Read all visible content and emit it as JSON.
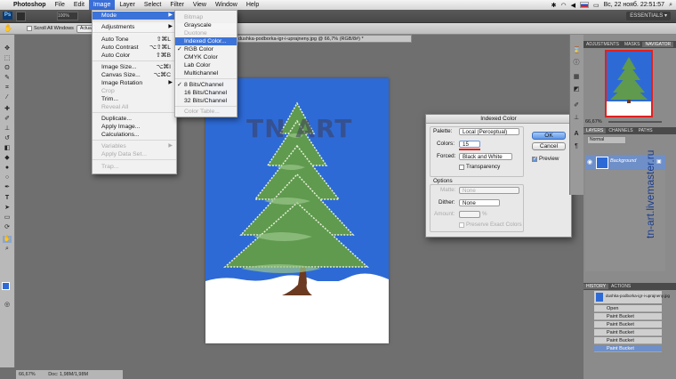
{
  "menubar": {
    "items": [
      "Photoshop",
      "File",
      "Edit",
      "Image",
      "Layer",
      "Select",
      "Filter",
      "View",
      "Window",
      "Help"
    ],
    "clock": "Вс, 22 нояб.  22:51:57"
  },
  "workspace": {
    "essentials": "ESSENTIALS ▾"
  },
  "optionsbar": {
    "scroll_all": "Scroll All Windows",
    "actual": "Actual"
  },
  "image_menu": {
    "mode": "Mode",
    "adjustments": "Adjustments",
    "auto_tone": "Auto Tone",
    "auto_tone_sc": "⇧⌘L",
    "auto_contrast": "Auto Contrast",
    "auto_contrast_sc": "⌥⇧⌘L",
    "auto_color": "Auto Color",
    "auto_color_sc": "⇧⌘B",
    "image_size": "Image Size...",
    "image_size_sc": "⌥⌘I",
    "canvas_size": "Canvas Size...",
    "canvas_size_sc": "⌥⌘C",
    "image_rotation": "Image Rotation",
    "crop": "Crop",
    "trim": "Trim...",
    "reveal_all": "Reveal All",
    "duplicate": "Duplicate...",
    "apply_image": "Apply Image...",
    "calculations": "Calculations...",
    "variables": "Variables",
    "apply_data_set": "Apply Data Set...",
    "trap": "Trap..."
  },
  "mode_menu": {
    "bitmap": "Bitmap",
    "grayscale": "Grayscale",
    "duotone": "Duotone",
    "indexed": "Indexed Color...",
    "rgb": "RGB Color",
    "cmyk": "CMYK Color",
    "lab": "Lab Color",
    "multichannel": "Multichannel",
    "b8": "8 Bits/Channel",
    "b16": "16 Bits/Channel",
    "b32": "32 Bits/Channel",
    "color_table": "Color Table..."
  },
  "doc_tab": {
    "title": "dushka-podborka-igr-i-uprajneny.jpg @ 66,7% (RGB/8#) *"
  },
  "canvas_watermark": "TN ART",
  "dialog": {
    "title": "Indexed Color",
    "palette_label": "Palette:",
    "palette_value": "Local (Perceptual)",
    "colors_label": "Colors:",
    "colors_value": "15",
    "forced_label": "Forced:",
    "forced_value": "Black and White",
    "transparency": "Transparency",
    "options_label": "Options",
    "matte_label": "Matte:",
    "matte_value": "None",
    "dither_label": "Dither:",
    "dither_value": "None",
    "amount_label": "Amount:",
    "amount_unit": "%",
    "preserve": "Preserve Exact Colors",
    "ok": "OK",
    "cancel": "Cancel",
    "preview": "Preview"
  },
  "navigator": {
    "tabs": [
      "ADJUSTMENTS",
      "MASKS",
      "NAVIGATOR"
    ],
    "zoom": "66,67%"
  },
  "layers": {
    "tabs": [
      "LAYERS",
      "CHANNELS",
      "PATHS"
    ],
    "blend": "Normal",
    "layer_name": "Background"
  },
  "history": {
    "tabs": [
      "HISTORY",
      "ACTIONS"
    ],
    "snapshot": "dushka-podborka-igr-i-uprajneny.jpg",
    "items": [
      "Open",
      "Paint Bucket",
      "Paint Bucket",
      "Paint Bucket",
      "Paint Bucket",
      "Paint Bucket"
    ]
  },
  "status": {
    "zoom": "66,67%",
    "doc": "Doc: 1,98M/1,98M"
  },
  "side_watermark": "tn-art.livemaster.ru",
  "colors": {
    "accent": "#3b73d9",
    "sky": "#2d6ad6",
    "tree": "#5f9a4e",
    "trunk": "#6b3a20"
  }
}
